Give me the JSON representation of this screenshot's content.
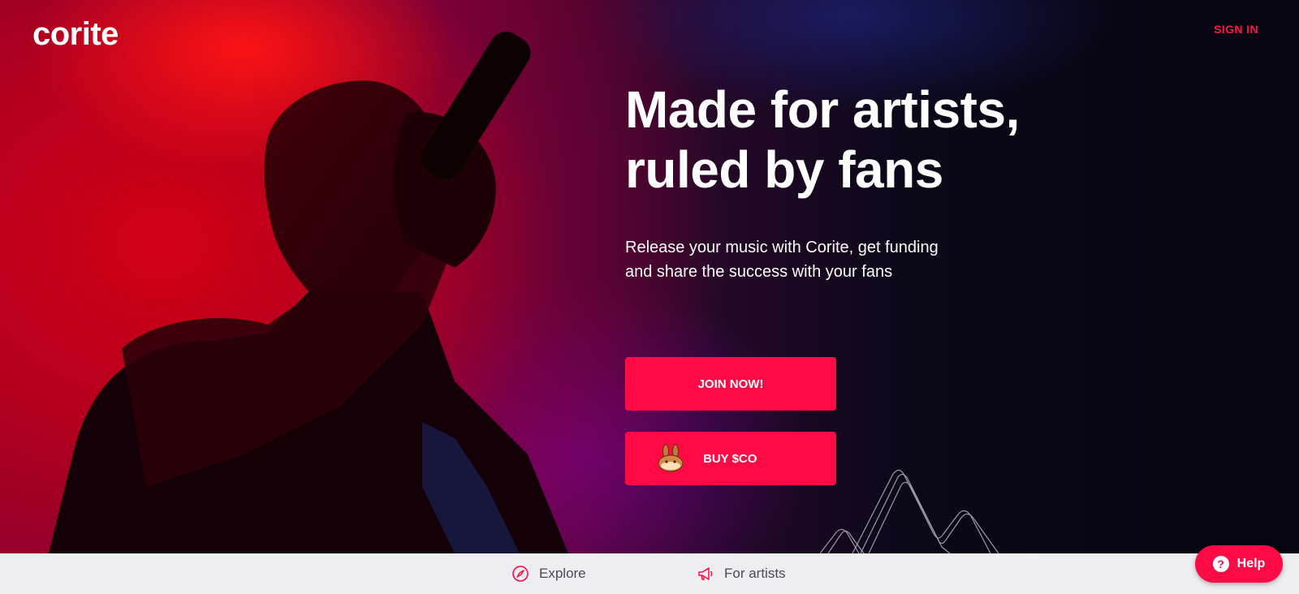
{
  "header": {
    "logo": "corite",
    "sign_in_label": "SIGN IN"
  },
  "hero": {
    "headline_line1": "Made for artists,",
    "headline_line2": "ruled by fans",
    "subtitle_line1": "Release your music with Corite, get funding",
    "subtitle_line2": "and share the success with your fans",
    "join_label": "JOIN NOW!",
    "buy_label": "BUY $CO",
    "buy_icon": "pancakeswap-bunny-icon"
  },
  "bottom_nav": {
    "items": [
      {
        "label": "Explore",
        "icon": "compass-icon"
      },
      {
        "label": "For artists",
        "icon": "megaphone-icon"
      }
    ]
  },
  "help": {
    "label": "Help",
    "icon": "question-circle-icon"
  },
  "colors": {
    "accent": "#ff0a45",
    "nav_background": "#eeedf1",
    "text_light": "#ffffff"
  }
}
